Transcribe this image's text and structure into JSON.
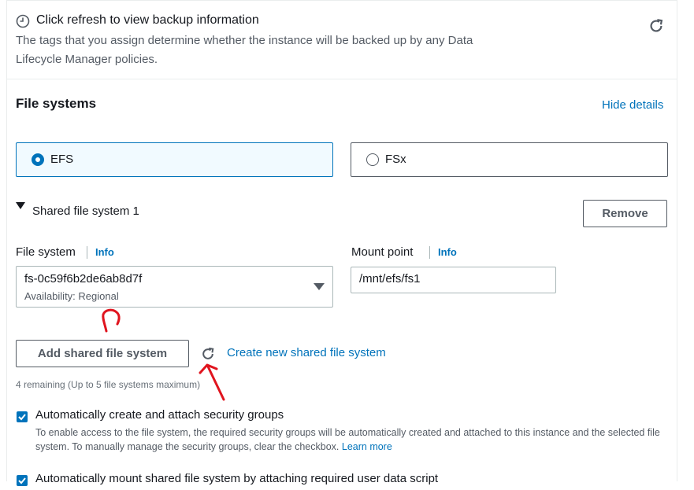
{
  "backup": {
    "title": "Click refresh to view backup information",
    "description": "The tags that you assign determine whether the instance will be backed up by any Data Lifecycle Manager policies.",
    "clock_icon": "clock-icon",
    "refresh_icon": "refresh-icon"
  },
  "file_systems": {
    "title": "File systems",
    "hide_details": "Hide details",
    "options": [
      {
        "label": "EFS",
        "selected": true
      },
      {
        "label": "FSx",
        "selected": false
      }
    ],
    "shared": {
      "title": "Shared file system 1",
      "remove": "Remove",
      "file_system_label": "File system",
      "file_system_info": "Info",
      "file_system_value": "fs-0c59f6b2de6ab8d7f",
      "file_system_availability": "Availability: Regional",
      "mount_point_label": "Mount point",
      "mount_point_info": "Info",
      "mount_point_value": "/mnt/efs/fs1"
    },
    "add_button": "Add shared file system",
    "create_link": "Create new shared file system",
    "remaining": "4 remaining (Up to 5 file systems maximum)"
  },
  "checkboxes": [
    {
      "checked": true,
      "label": "Automatically create and attach security groups",
      "description": "To enable access to the file system, the required security groups will be automatically created and attached to this instance and the selected file system. To manually manage the security groups, clear the checkbox.",
      "learn_more": "Learn more"
    },
    {
      "checked": true,
      "label": "Automatically mount shared file system by attaching required user data script"
    }
  ],
  "colors": {
    "link": "#0073bb",
    "selected_tile_bg": "#f1faff",
    "annotation": "#e0141e"
  }
}
